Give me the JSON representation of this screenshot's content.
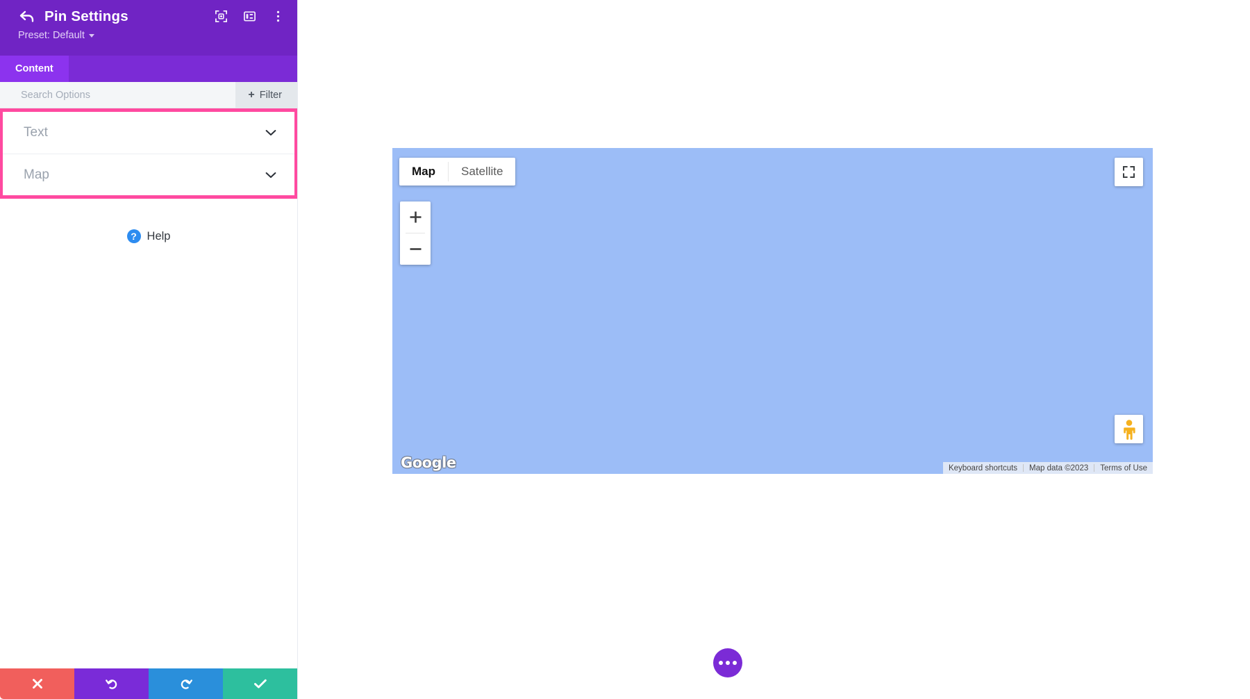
{
  "panel": {
    "title": "Pin Settings",
    "back_icon": "back-arrow-icon",
    "preset_label": "Preset: Default",
    "header_icons": [
      {
        "name": "focus-target-icon"
      },
      {
        "name": "layout-panel-icon"
      },
      {
        "name": "more-vertical-icon"
      }
    ],
    "tabs": [
      {
        "label": "Content",
        "active": true
      }
    ],
    "search": {
      "placeholder": "Search Options",
      "value": "",
      "filter_label": "Filter",
      "filter_plus": "+"
    },
    "toggles": [
      {
        "label": "Text",
        "expanded": false,
        "chevron": "chevron-down-icon"
      },
      {
        "label": "Map",
        "expanded": false,
        "chevron": "chevron-down-icon"
      }
    ],
    "highlight_color": "#ff4aa0",
    "help": {
      "icon_glyph": "?",
      "label": "Help",
      "icon_color": "#2d8cf0"
    },
    "actions": [
      {
        "name": "cancel",
        "glyph": "close-icon",
        "color": "#f15f5c"
      },
      {
        "name": "undo",
        "glyph": "undo-icon",
        "color": "#7a2bd8"
      },
      {
        "name": "redo",
        "glyph": "redo-icon",
        "color": "#2a8fdb"
      },
      {
        "name": "save",
        "glyph": "check-icon",
        "color": "#2dbf9e"
      }
    ],
    "colors": {
      "header_bg": "#7024c4",
      "tabbar_bg": "#7b2bd6",
      "tab_active_bg": "#8c33ee"
    }
  },
  "map": {
    "background_color": "#9cbdf7",
    "maptype": {
      "options": [
        "Map",
        "Satellite"
      ],
      "selected": "Map"
    },
    "zoom_controls": {
      "zoom_in": "+",
      "zoom_out": "−"
    },
    "fullscreen_icon": "fullscreen-expand-icon",
    "pegman_icon": "street-view-pegman-icon",
    "watermark": "Google",
    "attribution": {
      "keyboard_shortcuts": "Keyboard shortcuts",
      "map_data": "Map data ©2023",
      "terms": "Terms of Use"
    }
  },
  "fab": {
    "name": "more-options-fab",
    "dots": 3,
    "color": "#7b2bd6"
  }
}
